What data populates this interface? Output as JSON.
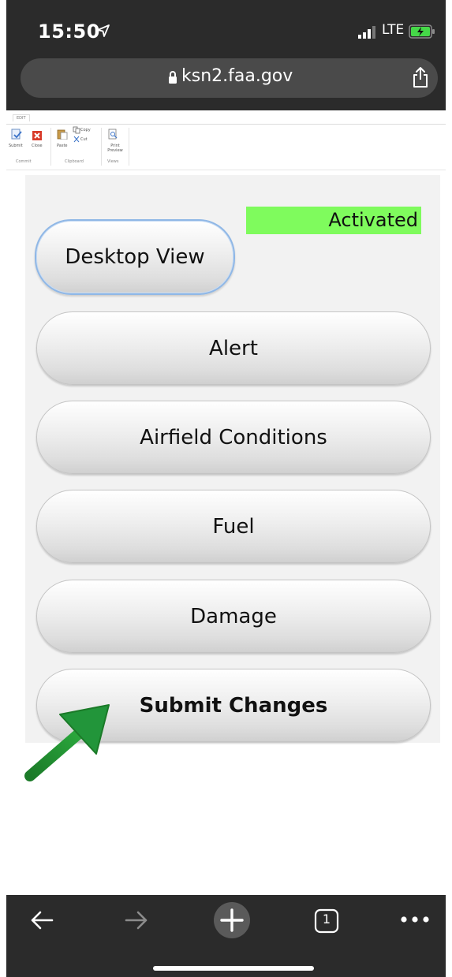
{
  "status_bar": {
    "time": "15:50",
    "network": "LTE"
  },
  "browser": {
    "url": "ksn2.faa.gov"
  },
  "ribbon": {
    "tab": "EDIT",
    "items": [
      {
        "label": "Submit",
        "icon": "submit-icon"
      },
      {
        "label": "Close",
        "icon": "close-icon"
      },
      {
        "label": "Paste",
        "icon": "paste-icon"
      },
      {
        "label": "Copy",
        "icon": "copy-icon"
      },
      {
        "label": "Cut",
        "icon": "cut-icon"
      },
      {
        "label": "Print Preview",
        "icon": "print-preview-icon"
      }
    ],
    "groups": [
      "Commit",
      "Clipboard",
      "Views"
    ]
  },
  "content": {
    "status_label": "Activated",
    "status_color": "#7ffb5d",
    "buttons": {
      "desktop_view": "Desktop View",
      "alert": "Alert",
      "airfield_conditions": "Airfield Conditions",
      "fuel": "Fuel",
      "damage": "Damage",
      "submit_changes": "Submit Changes"
    }
  },
  "annotation": {
    "arrow_color": "#1e8a2e"
  },
  "toolbar": {
    "tab_count": "1"
  }
}
